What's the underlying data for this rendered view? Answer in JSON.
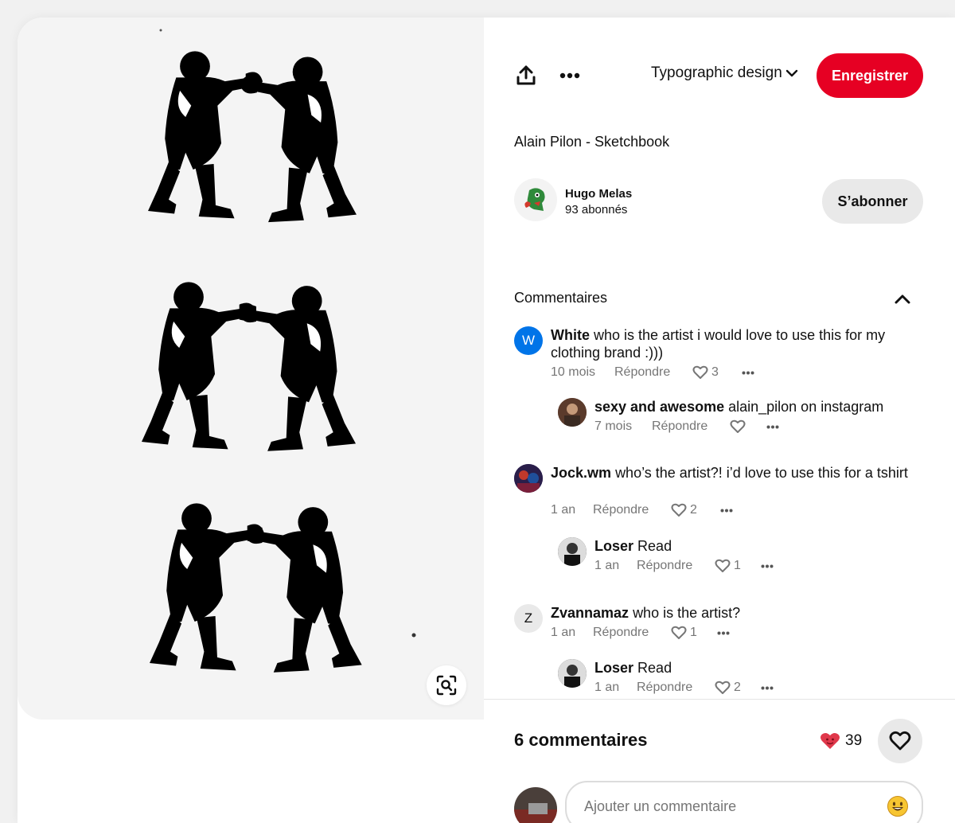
{
  "toolbar": {
    "share_icon": "share-upload-icon",
    "more_icon": "ellipsis-icon",
    "board_name": "Typographic design",
    "save_label": "Enregistrer"
  },
  "pin": {
    "title": "Alain Pilon - Sketchbook"
  },
  "creator": {
    "name": "Hugo Melas",
    "followers": "93 abonnés",
    "follow_label": "S’abonner"
  },
  "comments_section": {
    "title": "Commentaires",
    "items": [
      {
        "user": "White",
        "avatar_letter": "W",
        "text": "who is the artist i would love to use this for my clothing brand :)))",
        "time": "10 mois",
        "reply_label": "Répondre",
        "likes": "3",
        "replies": [
          {
            "user": "sexy and awesome",
            "text": "alain_pilon on instagram",
            "time": "7 mois",
            "reply_label": "Répondre",
            "likes": ""
          }
        ]
      },
      {
        "user": "Jock.wm",
        "text": "who’s the artist?! i’d love to use this for a tshirt",
        "time": "1 an",
        "reply_label": "Répondre",
        "likes": "2",
        "replies": [
          {
            "user": "Loser",
            "text": "Read",
            "time": "1 an",
            "reply_label": "Répondre",
            "likes": "1"
          }
        ]
      },
      {
        "user": "Zvannamaz",
        "avatar_letter": "Z",
        "text": "who is the artist?",
        "time": "1 an",
        "reply_label": "Répondre",
        "likes": "1",
        "replies": [
          {
            "user": "Loser",
            "text": "Read",
            "time": "1 an",
            "reply_label": "Répondre",
            "likes": "2"
          }
        ]
      }
    ]
  },
  "footer": {
    "comment_count": "6 commentaires",
    "reaction_count": "39",
    "reaction_icon": "heart-face-icon",
    "input_placeholder": "Ajouter un commentaire",
    "emoji_icon": "smiley-emoji-icon"
  },
  "colors": {
    "save_red": "#e60023",
    "follow_gray": "#e9e9e9",
    "meta_gray": "#767676",
    "white_avatar_blue": "#0074e8"
  }
}
